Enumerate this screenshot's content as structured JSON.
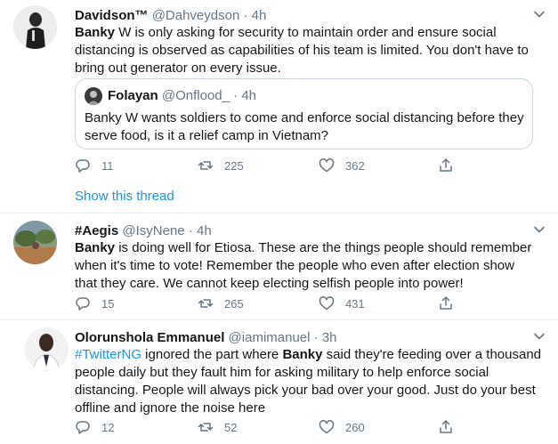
{
  "tweets": [
    {
      "name": "Davidson™",
      "handle": "@Dahveydson",
      "separator": "·",
      "time": "4h",
      "body_bold": "Banky",
      "body_rest": " W is only asking for security to maintain order and ensure social distancing is observed as capabilities of his team is limited. You don't have to bring out generator on every issue.",
      "quote": {
        "name": "Folayan",
        "handle": "@Onflood_",
        "separator": "·",
        "time": "4h",
        "body": "Banky W wants soldiers to come and enforce social distancing before they serve food, is it a relief camp in Vietnam?"
      },
      "replies": "11",
      "retweets": "225",
      "likes": "362",
      "show_thread": "Show this thread"
    },
    {
      "name": "#Aegis",
      "handle": "@IsyNene",
      "separator": "·",
      "time": "4h",
      "body_bold": "Banky",
      "body_rest": " is doing well for Etiosa. These are the things people should remember when it's time to vote! Remember the people who even after election show that they care. We cannot keep electing selfish people into power!",
      "replies": "15",
      "retweets": "265",
      "likes": "431"
    },
    {
      "name": "Olorunshola Emmanuel",
      "handle": "@iamimanuel",
      "separator": "·",
      "time": "3h",
      "hashtag": "#TwitterNG",
      "body_pre": " ignored the part where ",
      "body_bold": "Banky",
      "body_rest": " said they're feeding over a thousand people daily but they fault him for asking military to help enforce social distancing. People will always pick your bad over your good. Just do your best offline and ignore the noise here",
      "replies": "12",
      "retweets": "52",
      "likes": "260"
    }
  ],
  "icons": {
    "reply": "reply-icon",
    "retweet": "retweet-icon",
    "like": "heart-icon",
    "share": "share-icon",
    "caret": "chevron-down-icon"
  },
  "colors": {
    "link": "#1b95e0",
    "secondary_text": "#657786",
    "border": "#e6ecf0"
  }
}
